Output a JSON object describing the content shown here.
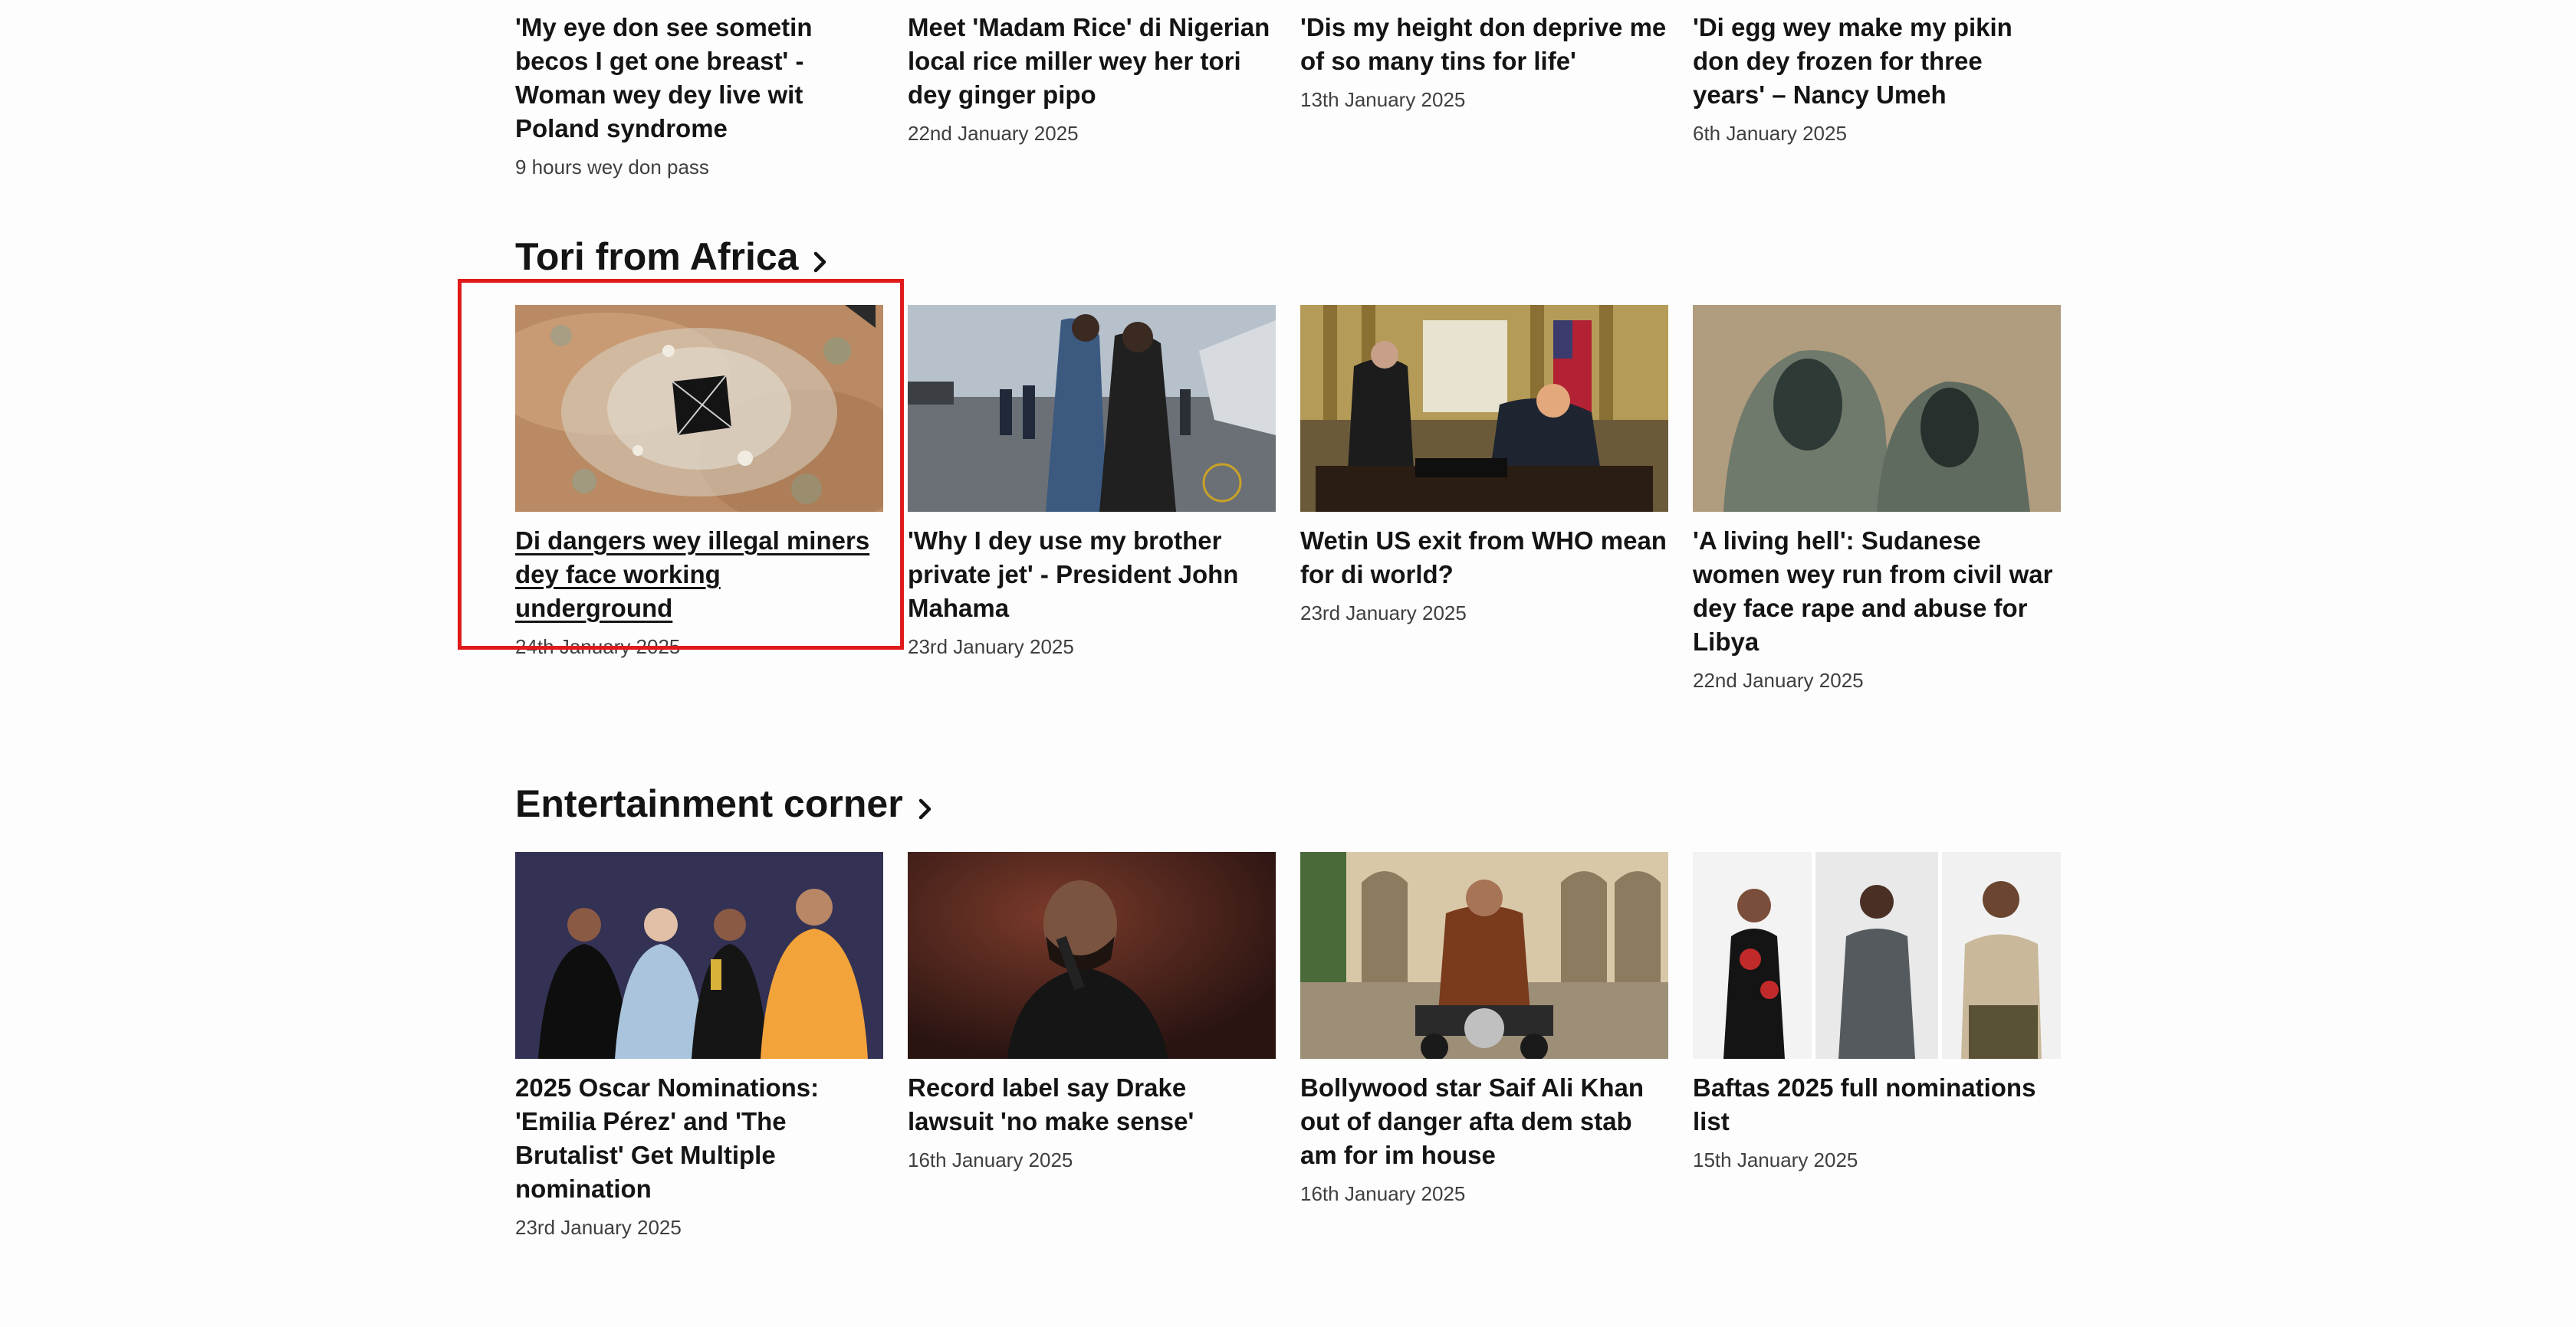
{
  "top_row": [
    {
      "headline": "'My eye don see sometin becos I get one breast' - Woman wey dey live wit Poland syndrome",
      "date": "9 hours wey don pass"
    },
    {
      "headline": "Meet 'Madam Rice' di Nigerian local rice miller wey her tori dey ginger pipo",
      "date": "22nd January 2025"
    },
    {
      "headline": "'Dis my height don deprive me of so many tins for life'",
      "date": "13th January 2025"
    },
    {
      "headline": "'Di egg wey make my pikin don dey frozen for three years' – Nancy Umeh",
      "date": "6th January 2025"
    }
  ],
  "africa": {
    "title": "Tori from Africa",
    "cards": [
      {
        "headline": "Di dangers wey illegal miners dey face working underground",
        "date": "24th January 2025",
        "image": "aerial-mine-shaft"
      },
      {
        "headline": "'Why I dey use my brother private jet' - President John Mahama",
        "date": "23rd January 2025",
        "image": "airport-handshake"
      },
      {
        "headline": "Wetin US exit from WHO mean for di world?",
        "date": "23rd January 2025",
        "image": "oval-office-signing"
      },
      {
        "headline": "'A living hell': Sudanese women wey run from civil war dey face rape and abuse for Libya",
        "date": "22nd January 2025",
        "image": "veiled-women-illustration"
      }
    ]
  },
  "entertainment": {
    "title": "Entertainment corner",
    "cards": [
      {
        "headline": "2025 Oscar Nominations: 'Emilia Pérez' and 'The Brutalist' Get Multiple nomination",
        "date": "23rd January 2025",
        "image": "golden-globes-group"
      },
      {
        "headline": "Record label say Drake lawsuit 'no make sense'",
        "date": "16th January 2025",
        "image": "rapper-on-stage"
      },
      {
        "headline": "Bollywood star Saif Ali Khan out of danger afta dem stab am for im house",
        "date": "16th January 2025",
        "image": "actor-on-motorbike"
      },
      {
        "headline": "Baftas 2025 full nominations list",
        "date": "15th January 2025",
        "image": "three-nominees"
      }
    ]
  },
  "colors": {
    "highlight": "#e01a1a",
    "text": "#141414",
    "date": "#3f3f42",
    "background": "#fdfdfd"
  }
}
